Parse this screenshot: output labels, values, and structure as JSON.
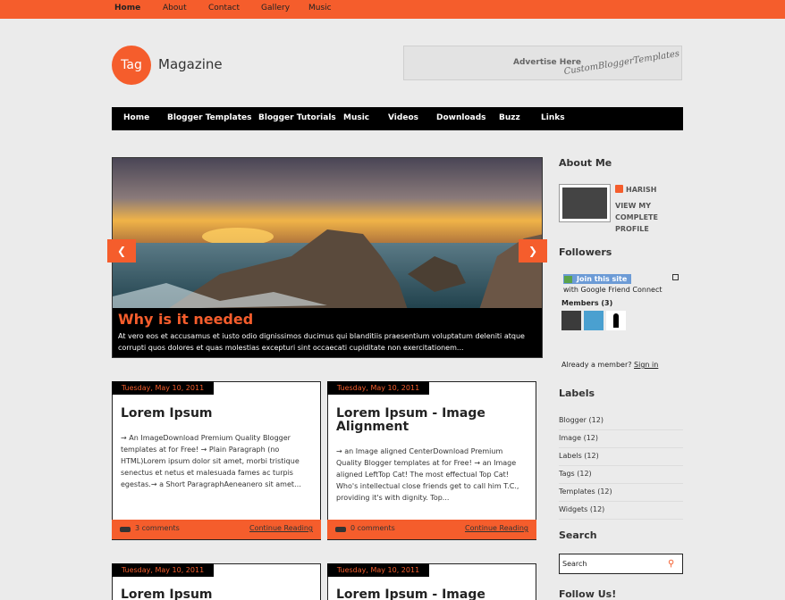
{
  "top_nav": [
    "Home",
    "About",
    "Contact",
    "Gallery",
    "Music"
  ],
  "logo": {
    "circle": "Tag",
    "text": "Magazine"
  },
  "ad": {
    "line1": "Advertise Here",
    "line2": "CustomBloggerTemplates"
  },
  "main_nav": [
    "Home",
    "Blogger Templates",
    "Blogger Tutorials",
    "Music",
    "Videos",
    "Downloads",
    "Buzz",
    "Links"
  ],
  "slider": {
    "title": "Why is it needed",
    "body": "At vero eos et accusamus et iusto odio dignissimos ducimus qui blanditiis praesentium voluptatum deleniti atque corrupti quos dolores et quas molestias excepturi sint occaecati cupiditate non exercitationem...",
    "prev_icon": "chevron-left-icon",
    "next_icon": "chevron-right-icon"
  },
  "posts": [
    {
      "date": "Tuesday, May 10, 2011",
      "title": "Lorem Ipsum",
      "body": "→ An ImageDownload Premium Quality Blogger templates at for Free! → Plain Paragraph (no HTML)Lorem ipsum dolor sit amet, morbi tristique senectus et netus et malesuada fames ac turpis egestas.→ a Short ParagraphAeneanero sit amet…",
      "comments": "3 comments",
      "read": "Continue Reading"
    },
    {
      "date": "Tuesday, May 10, 2011",
      "title": "Lorem Ipsum - Image Alignment",
      "body": "→ an Image aligned CenterDownload Premium Quality Blogger templates at for Free! → an Image aligned LeftTop Cat! The most effectual Top Cat! Who's intellectual close friends get to call him T.C., providing it's with dignity. Top...",
      "comments": "0 comments",
      "read": "Continue Reading"
    },
    {
      "date": "Tuesday, May 10, 2011",
      "title": "Lorem Ipsum"
    },
    {
      "date": "Tuesday, May 10, 2011",
      "title": "Lorem Ipsum - Image"
    }
  ],
  "sidebar": {
    "about_title": "About Me",
    "name": "HARISH",
    "profile": "VIEW MY COMPLETE PROFILE",
    "followers_title": "Followers",
    "join": "Join this site",
    "with": "with Google Friend Connect",
    "members": "Members (3)",
    "already": "Already a member?",
    "sign_in": "Sign in",
    "labels_title": "Labels",
    "labels": [
      "Blogger (12)",
      "Image (12)",
      "Labels (12)",
      "Tags (12)",
      "Templates (12)",
      "Widgets (12)"
    ],
    "search_title": "Search",
    "search_value": "Search",
    "follow_title": "Follow Us!"
  }
}
